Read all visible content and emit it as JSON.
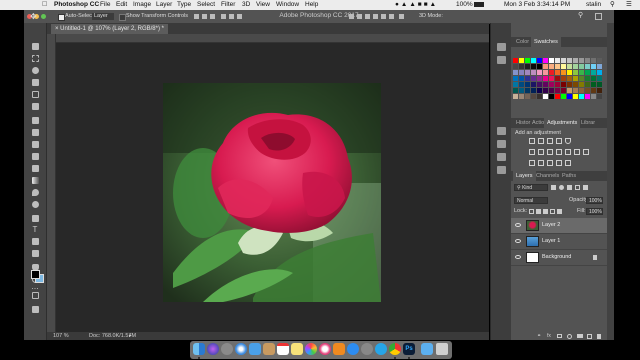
{
  "menubar": {
    "app": "Photoshop CC",
    "items": [
      "File",
      "Edit",
      "Image",
      "Layer",
      "Type",
      "Select",
      "Filter",
      "3D",
      "View",
      "Window",
      "Help"
    ],
    "battery": "100%",
    "datetime": "Mon 3 Feb  3:34:14 PM",
    "user": "stalin"
  },
  "options_bar": {
    "auto_select_label": "Auto-Select:",
    "auto_select_value": "Layer",
    "show_transform_label": "Show Transform Controls",
    "window_title": "Adobe Photoshop CC 2017"
  },
  "document": {
    "tab_title": "Untitled-1 @ 107% (Layer 2, RGB/8*) *",
    "zoom": "107 %",
    "doc_info": "Doc: 768.0K/1.57M"
  },
  "panels": {
    "color_tabs": [
      "Color",
      "Swatches"
    ],
    "adjust_tabs": [
      "Histor",
      "Action",
      "Adjustments",
      "Librar"
    ],
    "add_adjustment": "Add an adjustment",
    "layers_tabs": [
      "Layers",
      "Channels",
      "Paths"
    ],
    "kind": "Kind",
    "blend_mode": "Normal",
    "opacity_label": "Opacity:",
    "opacity_value": "100%",
    "lock_label": "Lock:",
    "fill_label": "Fill:",
    "fill_value": "100%",
    "layers": [
      {
        "name": "Layer 2",
        "selected": true
      },
      {
        "name": "Layer 1",
        "selected": false
      },
      {
        "name": "Background",
        "selected": false
      }
    ]
  },
  "colors": {
    "accent": "#2d7fd3",
    "panel": "#535353",
    "toolbar": "#434343",
    "canvas_bg": "#282828"
  }
}
